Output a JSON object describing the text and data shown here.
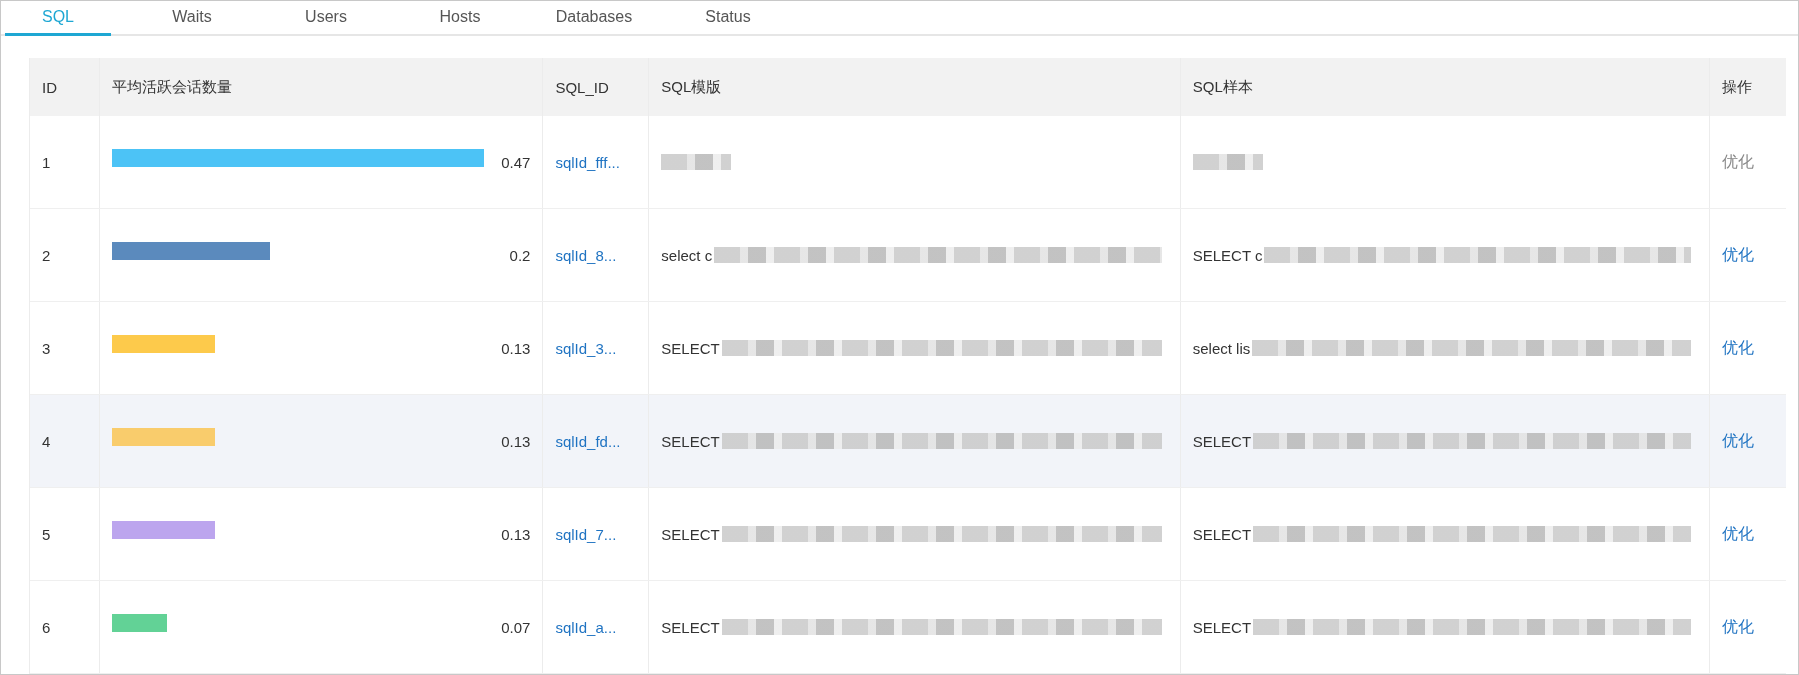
{
  "tabs": [
    {
      "label": "SQL",
      "selected": true
    },
    {
      "label": "Waits",
      "selected": false
    },
    {
      "label": "Users",
      "selected": false
    },
    {
      "label": "Hosts",
      "selected": false
    },
    {
      "label": "Databases",
      "selected": false
    },
    {
      "label": "Status",
      "selected": false
    }
  ],
  "table": {
    "columns": [
      "ID",
      "平均活跃会话数量",
      "SQL_ID",
      "SQL模版",
      "SQL样本",
      "操作"
    ],
    "rows": [
      {
        "id": "1",
        "color": "#4cc3f6",
        "value": "0.47",
        "sql_id": "sqlId_fff...",
        "template": "",
        "sample": "",
        "action": "优化",
        "disabled": true,
        "highlighted": false
      },
      {
        "id": "2",
        "color": "#5b8abd",
        "value": "0.2",
        "sql_id": "sqlId_8...",
        "template": "select c",
        "sample": "SELECT c",
        "action": "优化",
        "disabled": false,
        "highlighted": false
      },
      {
        "id": "3",
        "color": "#fdca4b",
        "value": "0.13",
        "sql_id": "sqlId_3...",
        "template": "SELECT",
        "sample": "select lis",
        "action": "优化",
        "disabled": false,
        "highlighted": false
      },
      {
        "id": "4",
        "color": "#f9cc6c",
        "value": "0.13",
        "sql_id": "sqlId_fd...",
        "template": "SELECT",
        "sample": "SELECT",
        "action": "优化",
        "disabled": false,
        "highlighted": true
      },
      {
        "id": "5",
        "color": "#bca5ee",
        "value": "0.13",
        "sql_id": "sqlId_7...",
        "template": "SELECT",
        "sample": "SELECT",
        "action": "优化",
        "disabled": false,
        "highlighted": false
      },
      {
        "id": "6",
        "color": "#62d296",
        "value": "0.07",
        "sql_id": "sqlId_a...",
        "template": "SELECT",
        "sample": "SELECT",
        "action": "优化",
        "disabled": false,
        "highlighted": false
      }
    ]
  }
}
